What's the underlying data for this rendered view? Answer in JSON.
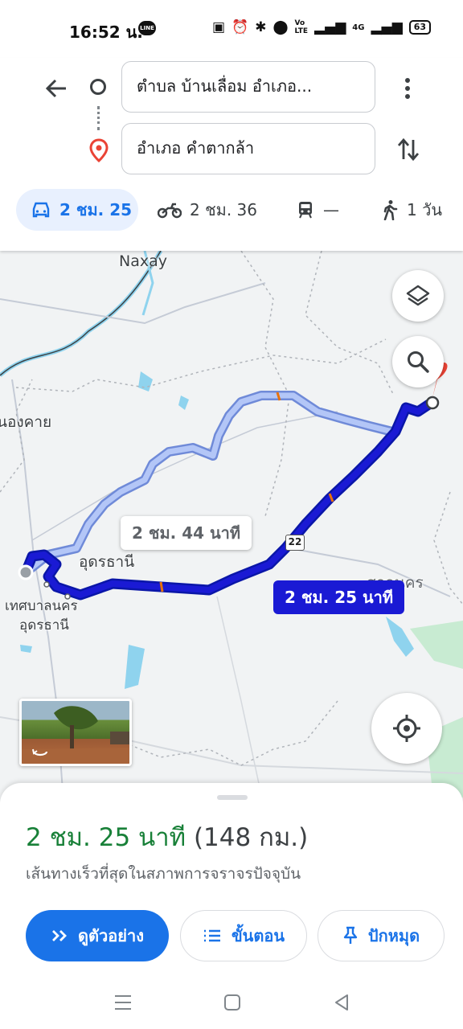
{
  "status_bar": {
    "time": "16:52 น.",
    "line_badge": "LINE",
    "battery": "63",
    "network": "4G"
  },
  "directions": {
    "origin": "ตำบล บ้านเลื่อม อำเภอ...",
    "destination": "อำเภอ คำตากล้า"
  },
  "modes": [
    {
      "name": "car",
      "label": "2 ชม. 25",
      "active": true
    },
    {
      "name": "motorcycle",
      "label": "2 ชม. 36"
    },
    {
      "name": "transit",
      "label": "—"
    },
    {
      "name": "walk",
      "label": "1 วัน"
    }
  ],
  "map": {
    "labels": {
      "naxay": "Naxay",
      "nongkhai": "นองคาย",
      "udon": "อุดรธานี",
      "udon_city_1": "เทศบาลนคร",
      "udon_city_2": "อุดรธานี",
      "sakon": "สกลนคร"
    },
    "highway": "22",
    "alt_route_time": "2 ชม. 44 นาที",
    "main_route_time": "2 ชม. 25 นาที",
    "colors": {
      "route_main": "#1a1ad4",
      "route_alt": "#a9bcf0",
      "water": "#8fd3ee",
      "park": "#c8ebd2",
      "destination_pin": "#ea4335"
    }
  },
  "sheet": {
    "duration": "2 ชม. 25 นาที",
    "distance": "(148 กม.)",
    "subtitle": "เส้นทางเร็วที่สุดในสภาพการจราจรปัจจุบัน",
    "buttons": {
      "preview": "ดูตัวอย่าง",
      "steps": "ขั้นตอน",
      "pin": "ปักหมุด"
    }
  }
}
